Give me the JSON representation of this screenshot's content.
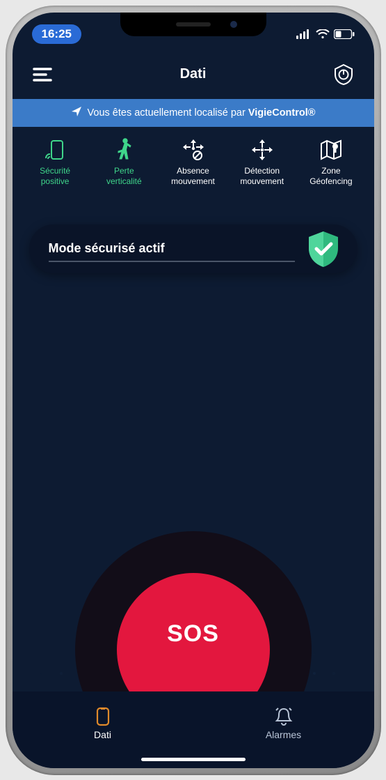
{
  "status_bar": {
    "time": "16:25"
  },
  "header": {
    "title": "Dati"
  },
  "banner": {
    "prefix": "Vous êtes actuellement localisé par ",
    "brand": "VigieControl®"
  },
  "features": [
    {
      "label_line1": "Sécurité",
      "label_line2": "positive",
      "icon": "phone-signal"
    },
    {
      "label_line1": "Perte",
      "label_line2": "verticalité",
      "icon": "walk"
    },
    {
      "label_line1": "Absence",
      "label_line2": "mouvement",
      "icon": "move-off"
    },
    {
      "label_line1": "Détection",
      "label_line2": "mouvement",
      "icon": "move"
    },
    {
      "label_line1": "Zone",
      "label_line2": "Géofencing",
      "icon": "map"
    }
  ],
  "secure_status": {
    "text": "Mode sécurisé actif"
  },
  "sos": {
    "label": "SOS"
  },
  "tabs": [
    {
      "label": "Dati",
      "active": true
    },
    {
      "label": "Alarmes",
      "active": false
    }
  ]
}
